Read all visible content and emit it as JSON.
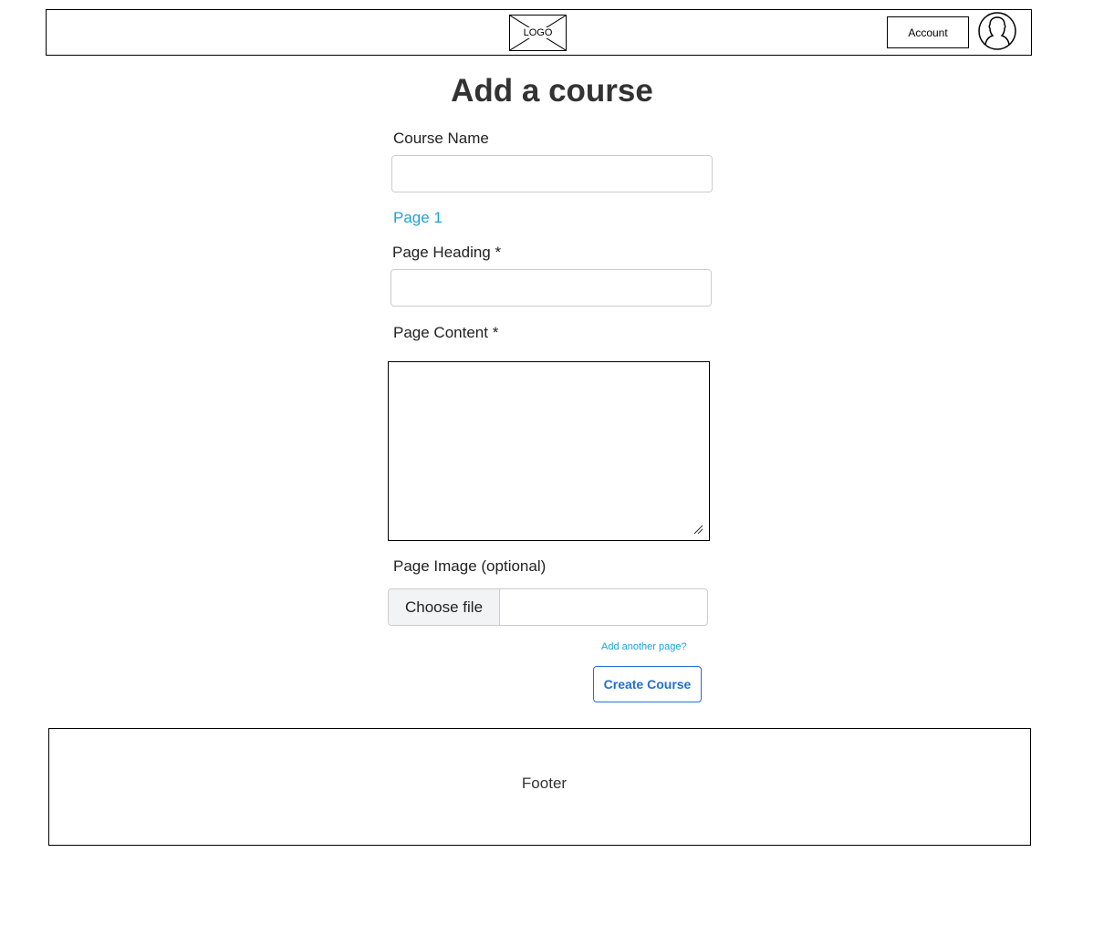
{
  "header": {
    "logo_text": "LOGO",
    "account_label": "Account"
  },
  "main": {
    "title": "Add a course",
    "course_name_label": "Course Name",
    "course_name_value": "",
    "page_link": "Page 1",
    "page_heading_label": "Page Heading *",
    "page_heading_value": "",
    "page_content_label": "Page Content *",
    "page_content_value": "",
    "page_image_label": "Page Image (optional)",
    "choose_file_label": "Choose file",
    "add_page_link": "Add another page?",
    "create_button_label": "Create Course"
  },
  "footer": {
    "text": "Footer"
  },
  "colors": {
    "link": "#1fa1d8",
    "primary_button": "#1f6fd0",
    "title_text": "#333333"
  },
  "icons": {
    "logo": "image-placeholder-icon",
    "avatar": "user-avatar-icon",
    "resize": "resize-grip-icon"
  }
}
